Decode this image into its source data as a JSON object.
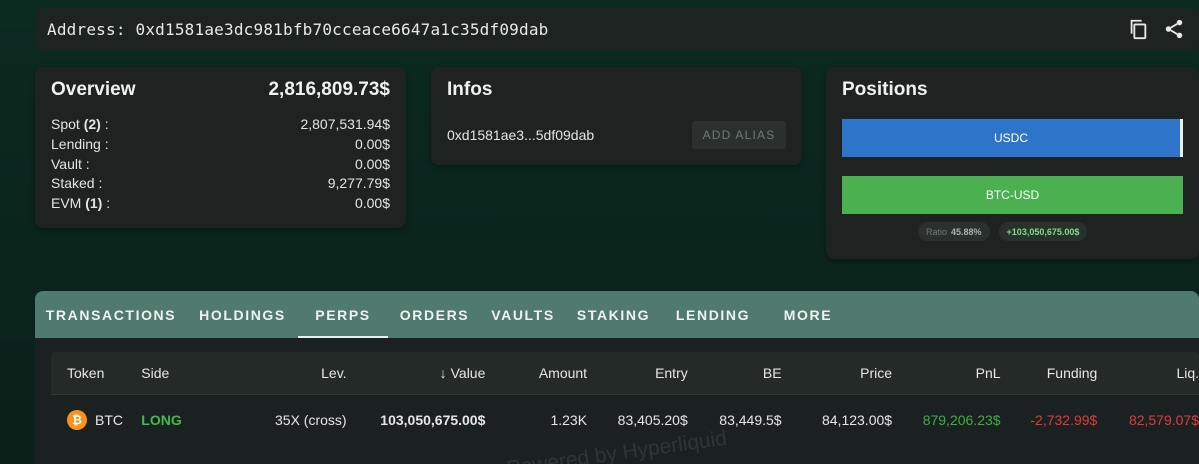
{
  "address_bar": {
    "label": "Address:",
    "address": "0xd1581ae3dc981bfb70cceace6647a1c35df09dab",
    "copy_icon": "copy-icon",
    "share_icon": "share-icon"
  },
  "overview": {
    "title": "Overview",
    "total": "2,816,809.73$",
    "rows": [
      {
        "label": "Spot",
        "count": "(2)",
        "suffix": " :",
        "value": "2,807,531.94$"
      },
      {
        "label": "Lending :",
        "count": "",
        "suffix": "",
        "value": "0.00$"
      },
      {
        "label": "Vault :",
        "count": "",
        "suffix": "",
        "value": "0.00$"
      },
      {
        "label": "Staked :",
        "count": "",
        "suffix": "",
        "value": "9,277.79$"
      },
      {
        "label": "EVM",
        "count": "(1)",
        "suffix": " :",
        "value": "0.00$"
      }
    ]
  },
  "infos": {
    "title": "Infos",
    "short_address": "0xd1581ae3...5df09dab",
    "add_alias_label": "ADD ALIAS"
  },
  "positions": {
    "title": "Positions",
    "bars": [
      {
        "label": "USDC",
        "color": "#2e74c9"
      },
      {
        "label": "BTC-USD",
        "color": "#4bb04f"
      }
    ],
    "ratio_label": "Ratio",
    "ratio_value": "45.88%",
    "pnl_badge": "+103,050,675.00$"
  },
  "tabs": [
    {
      "label": "TRANSACTIONS",
      "active": false
    },
    {
      "label": "HOLDINGS",
      "active": false
    },
    {
      "label": "PERPS",
      "active": true
    },
    {
      "label": "ORDERS",
      "active": false
    },
    {
      "label": "VAULTS",
      "active": false
    },
    {
      "label": "STAKING",
      "active": false
    },
    {
      "label": "LENDING",
      "active": false
    },
    {
      "label": "MORE",
      "active": false
    }
  ],
  "table": {
    "headers": {
      "token": "Token",
      "side": "Side",
      "lev": "Lev.",
      "value": "Value",
      "amount": "Amount",
      "entry": "Entry",
      "be": "BE",
      "price": "Price",
      "pnl": "PnL",
      "funding": "Funding",
      "liq": "Liq."
    },
    "sort_icon": "arrow-down-icon",
    "rows": [
      {
        "token": "BTC",
        "token_icon": "bitcoin-icon",
        "coin_glyph": "₿",
        "side": "LONG",
        "lev": "35X (cross)",
        "value": "103,050,675.00$",
        "amount": "1.23K",
        "entry": "83,405.20$",
        "be": "83,449.5$",
        "price": "84,123.00$",
        "pnl": "879,206.23$",
        "funding": "-2,732.99$",
        "liq": "82,579.07$"
      }
    ]
  },
  "watermark": "Powered by Hyperliquid",
  "colors": {
    "long": "#3fbf4a",
    "positive": "#3fae43",
    "negative": "#e03b3b",
    "tab_bar": "#4f7a6d"
  }
}
